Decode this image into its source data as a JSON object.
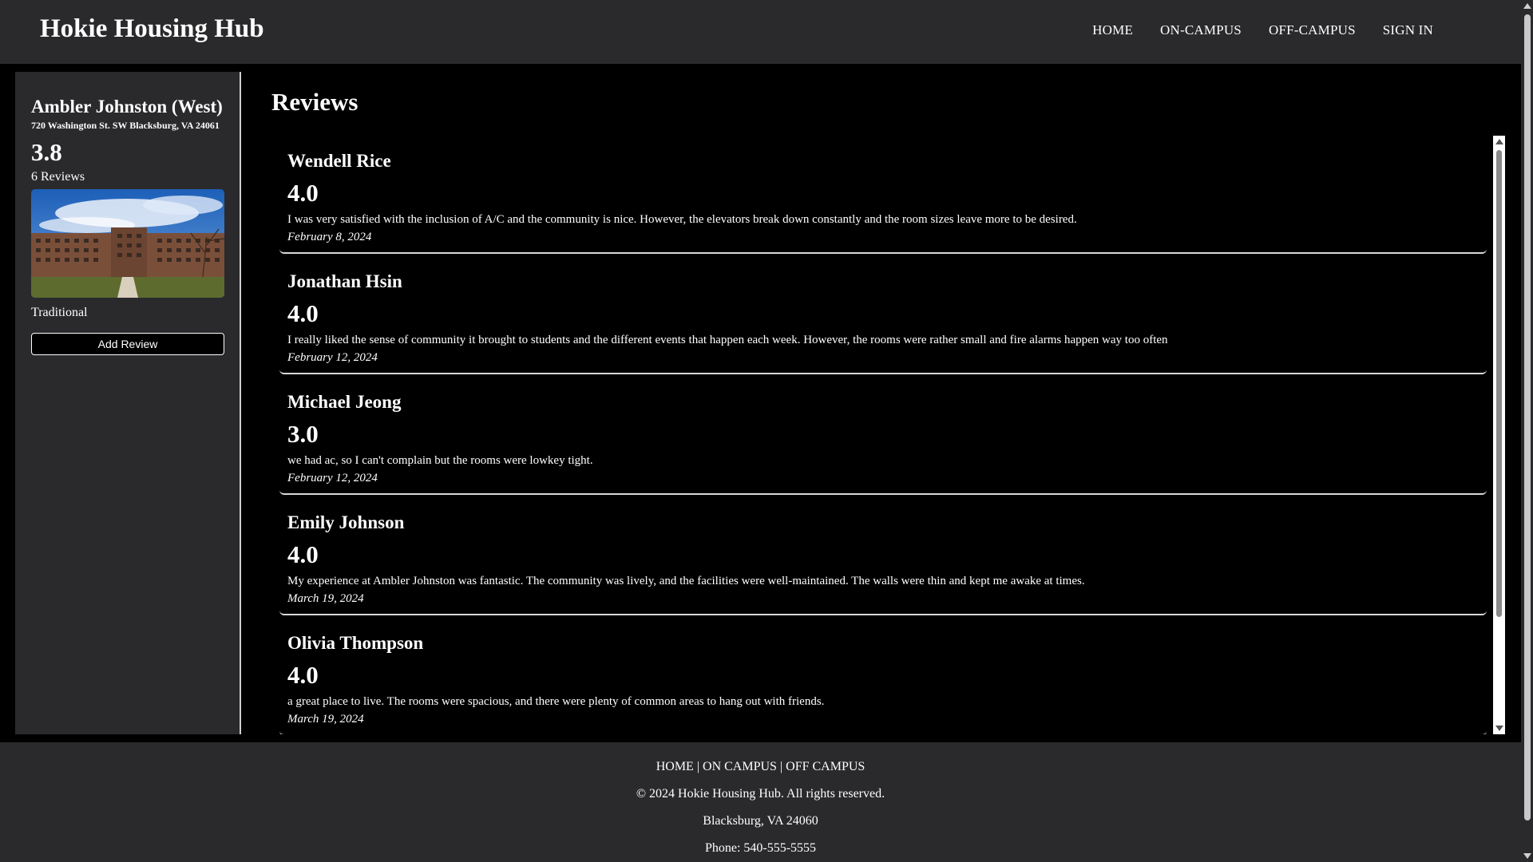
{
  "header": {
    "brand": "Hokie Housing Hub",
    "nav": [
      {
        "label": "HOME"
      },
      {
        "label": "ON-CAMPUS"
      },
      {
        "label": "OFF-CAMPUS"
      },
      {
        "label": "SIGN IN"
      }
    ]
  },
  "sidebar": {
    "name": "Ambler Johnston (West)",
    "address": "720 Washington St. SW Blacksburg, VA 24061",
    "rating": "3.8",
    "review_count": "6 Reviews",
    "type": "Traditional",
    "add_review_label": "Add Review"
  },
  "main": {
    "title": "Reviews",
    "reviews": [
      {
        "name": "Wendell Rice",
        "rating": "4.0",
        "text": "I was very satisfied with the inclusion of A/C and the community is nice. However, the elevators break down constantly and the room sizes leave more to be desired.",
        "date": "February 8, 2024"
      },
      {
        "name": "Jonathan Hsin",
        "rating": "4.0",
        "text": "I really liked the sense of community it brought to students and the different events that happen each week. However, the rooms were rather small and fire alarms happen way too often",
        "date": "February 12, 2024"
      },
      {
        "name": "Michael Jeong",
        "rating": "3.0",
        "text": "we had ac, so I can't complain but the rooms were lowkey tight.",
        "date": "February 12, 2024"
      },
      {
        "name": "Emily Johnson",
        "rating": "4.0",
        "text": "My experience at Ambler Johnston was fantastic. The community was lively, and the facilities were well-maintained. The walls were thin and kept me awake at times.",
        "date": "March 19, 2024"
      },
      {
        "name": "Olivia Thompson",
        "rating": "4.0",
        "text": "a great place to live. The rooms were spacious, and there were plenty of common areas to hang out with friends.",
        "date": "March 19, 2024"
      }
    ]
  },
  "footer": {
    "link_home": "HOME",
    "sep1": " | ",
    "link_on": "ON CAMPUS",
    "sep2": " | ",
    "link_off": "OFF CAMPUS",
    "copyright": "© 2024 Hokie Housing Hub. All rights reserved.",
    "location": "Blacksburg, VA 24060",
    "phone": "Phone: 540-555-5555"
  }
}
